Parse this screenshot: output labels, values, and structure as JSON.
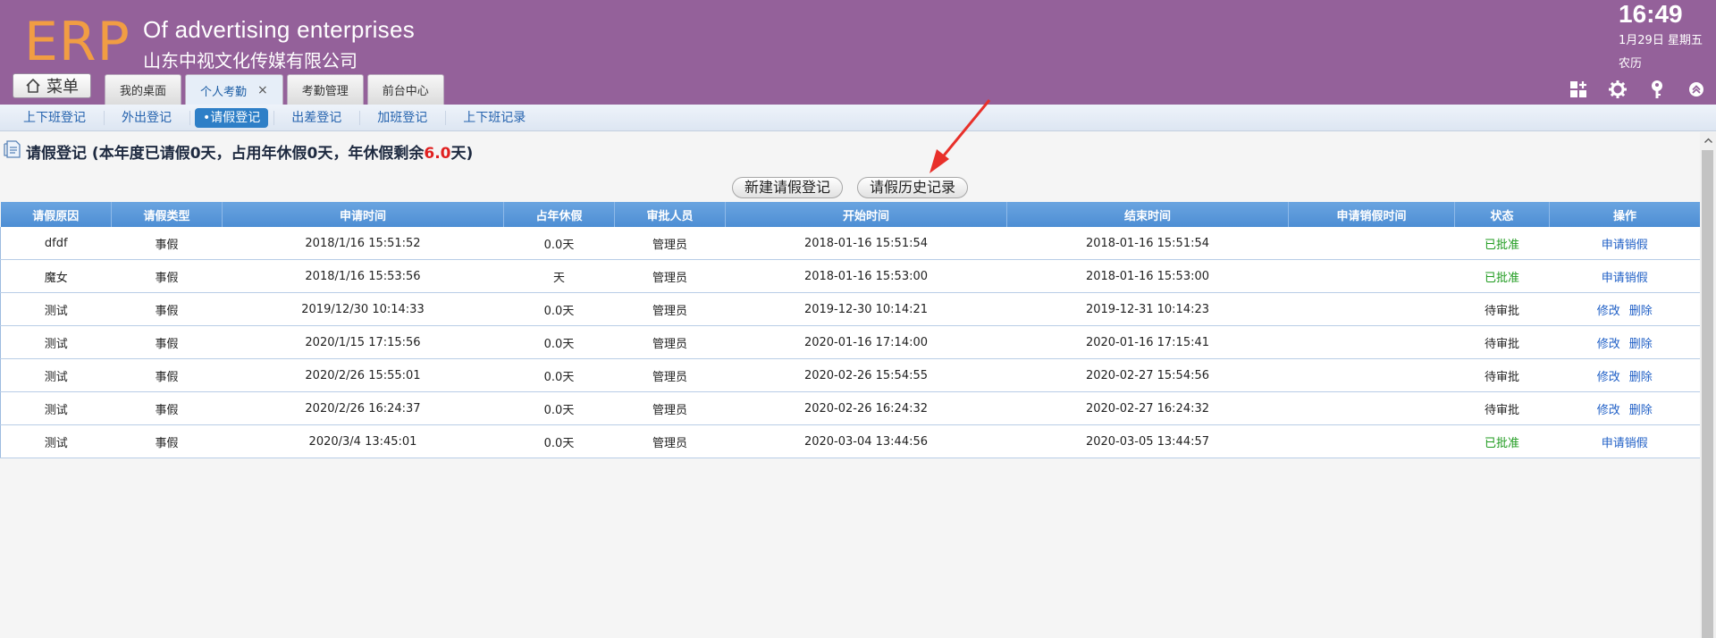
{
  "header": {
    "logo": "ERP",
    "company_en": "Of advertising enterprises",
    "company_cn": "山东中视文化传媒有限公司",
    "menu_label": "菜单",
    "clock": "16:49",
    "date": "1月29日 星期五",
    "lunar": "农历",
    "tabs": [
      {
        "label": "我的桌面",
        "active": false
      },
      {
        "label": "个人考勤",
        "active": true,
        "close": "×"
      },
      {
        "label": "考勤管理",
        "active": false
      },
      {
        "label": "前台中心",
        "active": false
      }
    ],
    "icons": [
      "grid-add-icon",
      "gear-icon",
      "key-icon",
      "collapse-up-icon"
    ]
  },
  "subnav": {
    "items": [
      {
        "label": "上下班登记"
      },
      {
        "label": "外出登记"
      },
      {
        "label": "•请假登记",
        "active": true
      },
      {
        "label": "出差登记"
      },
      {
        "label": "加班登记"
      },
      {
        "label": "上下班记录"
      }
    ]
  },
  "page": {
    "title_prefix": "请假登记 (本年度已请假0天，占用年休假0天，年休假剩余",
    "title_number": "6.0",
    "title_suffix": "天)",
    "new_button": "新建请假登记",
    "history_button": "请假历史记录"
  },
  "table": {
    "columns": [
      "请假原因",
      "请假类型",
      "申请时间",
      "占年休假",
      "审批人员",
      "开始时间",
      "结束时间",
      "申请销假时间",
      "状态",
      "操作"
    ],
    "rows": [
      {
        "reason": "dfdf",
        "type": "事假",
        "apply": "2018/1/16 15:51:52",
        "annual": "0.0天",
        "approver": "管理员",
        "start": "2018-01-16 15:51:54",
        "end": "2018-01-16 15:51:54",
        "cancel_time": "",
        "status": "已批准",
        "status_color": "#1f9b1f",
        "ops": [
          "申请销假"
        ]
      },
      {
        "reason": "魔女",
        "type": "事假",
        "apply": "2018/1/16 15:53:56",
        "annual": "天",
        "approver": "管理员",
        "start": "2018-01-16 15:53:00",
        "end": "2018-01-16 15:53:00",
        "cancel_time": "",
        "status": "已批准",
        "status_color": "#1f9b1f",
        "ops": [
          "申请销假"
        ]
      },
      {
        "reason": "测试",
        "type": "事假",
        "apply": "2019/12/30 10:14:33",
        "annual": "0.0天",
        "approver": "管理员",
        "start": "2019-12-30 10:14:21",
        "end": "2019-12-31 10:14:23",
        "cancel_time": "",
        "status": "待审批",
        "status_color": "#222222",
        "ops": [
          "修改",
          "删除"
        ]
      },
      {
        "reason": "测试",
        "type": "事假",
        "apply": "2020/1/15 17:15:56",
        "annual": "0.0天",
        "approver": "管理员",
        "start": "2020-01-16 17:14:00",
        "end": "2020-01-16 17:15:41",
        "cancel_time": "",
        "status": "待审批",
        "status_color": "#222222",
        "ops": [
          "修改",
          "删除"
        ]
      },
      {
        "reason": "测试",
        "type": "事假",
        "apply": "2020/2/26 15:55:01",
        "annual": "0.0天",
        "approver": "管理员",
        "start": "2020-02-26 15:54:55",
        "end": "2020-02-27 15:54:56",
        "cancel_time": "",
        "status": "待审批",
        "status_color": "#222222",
        "ops": [
          "修改",
          "删除"
        ]
      },
      {
        "reason": "测试",
        "type": "事假",
        "apply": "2020/2/26 16:24:37",
        "annual": "0.0天",
        "approver": "管理员",
        "start": "2020-02-26 16:24:32",
        "end": "2020-02-27 16:24:32",
        "cancel_time": "",
        "status": "待审批",
        "status_color": "#222222",
        "ops": [
          "修改",
          "删除"
        ]
      },
      {
        "reason": "测试",
        "type": "事假",
        "apply": "2020/3/4 13:45:01",
        "annual": "0.0天",
        "approver": "管理员",
        "start": "2020-03-04 13:44:56",
        "end": "2020-03-05 13:44:57",
        "cancel_time": "",
        "status": "已批准",
        "status_color": "#1f9b1f",
        "ops": [
          "申请销假"
        ]
      }
    ]
  },
  "colors": {
    "header_bg": "#94619a",
    "logo": "#f19d43",
    "table_header": "#5a98da",
    "link": "#1f5fc6",
    "approved": "#1f9b1f",
    "highlight": "#e02020",
    "annotation_arrow": "#e8302a"
  }
}
